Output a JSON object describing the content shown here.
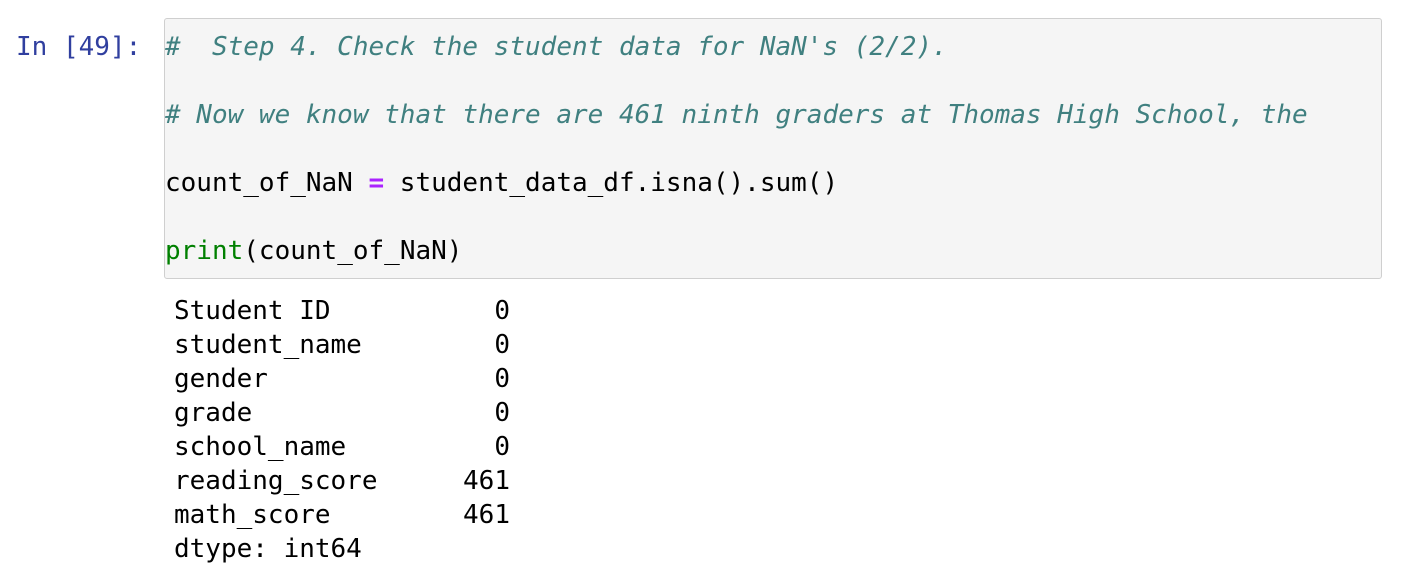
{
  "cell": {
    "prompt": "In [49]:",
    "code": {
      "comment_1": "#  Step 4. Check the student data for NaN's (2/2).",
      "comment_2": "# Now we know that there are 461 ninth graders at Thomas High School, the",
      "assign_lhs": "count_of_NaN ",
      "assign_op": "=",
      "assign_rhs": " student_data_df.isna().sum()",
      "print_fn": "print",
      "print_args": "(count_of_NaN)"
    }
  },
  "output": {
    "rows": [
      {
        "key": "Student ID",
        "value": "0"
      },
      {
        "key": "student_name",
        "value": "0"
      },
      {
        "key": "gender",
        "value": "0"
      },
      {
        "key": "grade",
        "value": "0"
      },
      {
        "key": "school_name",
        "value": "0"
      },
      {
        "key": "reading_score",
        "value": "461"
      },
      {
        "key": "math_score",
        "value": "461"
      }
    ],
    "dtype_line": "dtype: int64"
  },
  "colors": {
    "prompt": "#303f9f",
    "comment": "#408080",
    "operator": "#aa22ff",
    "builtin": "#008000",
    "cell_background": "#f5f5f5",
    "cell_border": "#cfcfcf"
  }
}
